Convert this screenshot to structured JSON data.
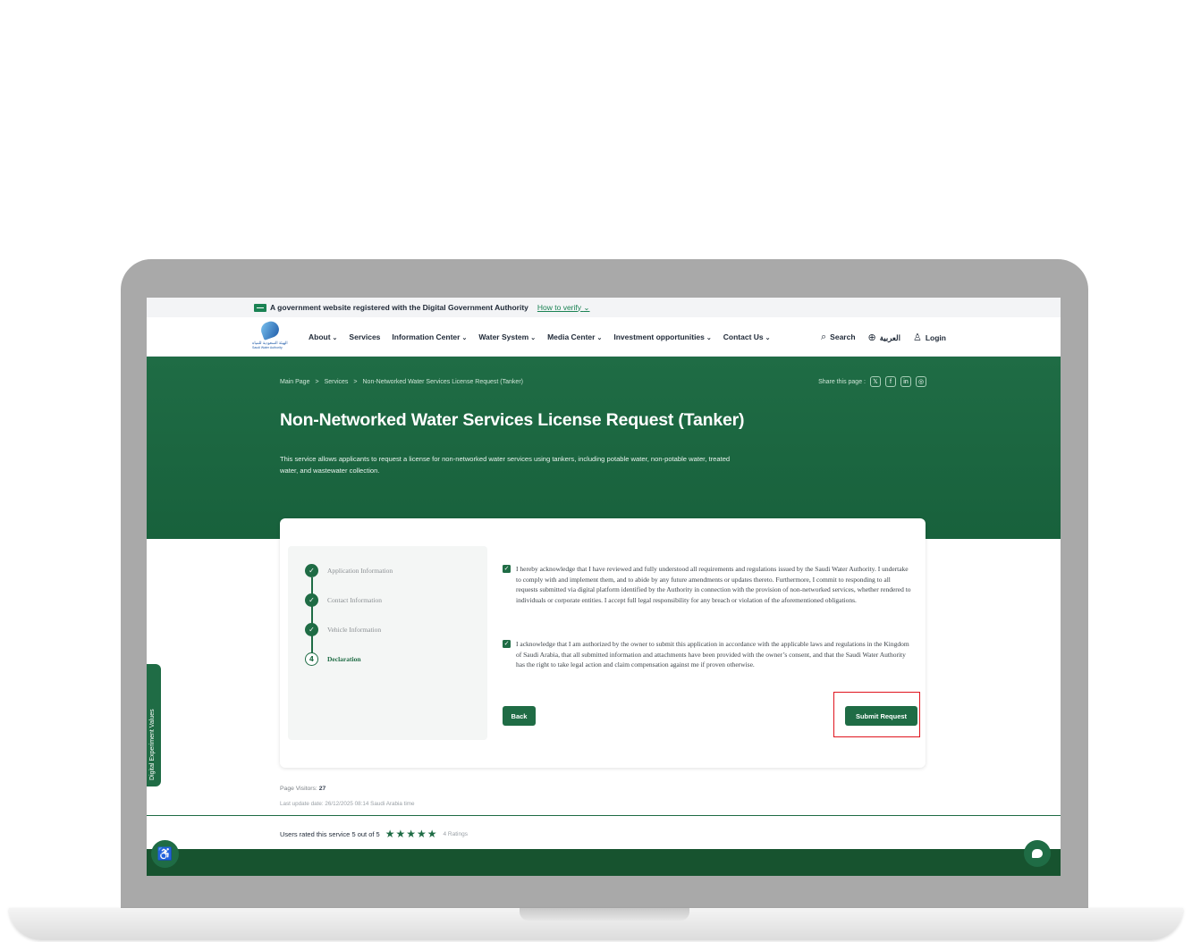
{
  "gov_banner": {
    "text": "A government website registered with the Digital Government Authority",
    "verify_link": "How to verify",
    "verify_chevron": "⌄"
  },
  "logo": {
    "arabic": "الهيئة السعودية للمياه",
    "english": "Saudi Water Authority"
  },
  "nav": {
    "items": [
      {
        "label": "About",
        "chevron": true
      },
      {
        "label": "Services",
        "chevron": false
      },
      {
        "label": "Information Center",
        "chevron": true
      },
      {
        "label": "Water System",
        "chevron": true
      },
      {
        "label": "Media Center",
        "chevron": true
      },
      {
        "label": "Investment opportunities",
        "chevron": true
      },
      {
        "label": "Contact Us",
        "chevron": true
      }
    ],
    "search": "Search",
    "language": "العربية",
    "login": "Login"
  },
  "breadcrumb": {
    "items": [
      "Main Page",
      "Services",
      "Non-Networked Water Services License Request (Tanker)"
    ],
    "separator": ">"
  },
  "share": {
    "label": "Share this page :",
    "icons": [
      "x-icon",
      "facebook-icon",
      "linkedin-icon",
      "whatsapp-icon"
    ],
    "glyphs": [
      "𝕏",
      "f",
      "in",
      "◎"
    ]
  },
  "hero": {
    "title": "Non-Networked Water Services License Request (Tanker)",
    "description": "This service allows applicants to request a license for non-networked water services using tankers, including potable water, non-potable water, treated water, and wastewater collection."
  },
  "steps": [
    {
      "number": "✓",
      "label": "Application Information",
      "status": "completed"
    },
    {
      "number": "✓",
      "label": "Contact Information",
      "status": "completed"
    },
    {
      "number": "✓",
      "label": "Vehicle Information",
      "status": "completed"
    },
    {
      "number": "4",
      "label": "Declaration",
      "status": "active"
    }
  ],
  "declarations": [
    {
      "checked": true,
      "text": "I hereby acknowledge that I have reviewed and fully understood all requirements and regulations issued by the Saudi Water Authority. I undertake to comply with and implement them, and to abide by any future amendments or updates thereto. Furthermore, I commit to responding to all requests submitted via digital platform identified by the Authority in connection with the provision of non-networked services, whether rendered to individuals or corporate entities. I accept full legal responsibility for any breach or violation of the aforementioned obligations."
    },
    {
      "checked": true,
      "text": "I acknowledge that I am authorized by the owner to submit this application in accordance with the applicable laws and regulations in the Kingdom of Saudi Arabia, that all submitted information and attachments have been provided with the owner’s consent, and that the Saudi Water Authority has the right to take legal action and claim compensation against me if proven otherwise."
    }
  ],
  "buttons": {
    "back": "Back",
    "submit": "Submit Request"
  },
  "page_info": {
    "visitors_label": "Page Visitors:",
    "visitors_count": "27",
    "last_update": "Last update date: 26/12/2025 08:14 Saudi Arabia time"
  },
  "rating": {
    "text": "Users rated this service 5 out of 5",
    "stars": "★★★★★",
    "score": 5,
    "count": "4 Ratings"
  },
  "side_tab": "Digital Experiment Values",
  "colors": {
    "brand_green": "#1f6c45",
    "highlight_red": "#e0141e"
  }
}
